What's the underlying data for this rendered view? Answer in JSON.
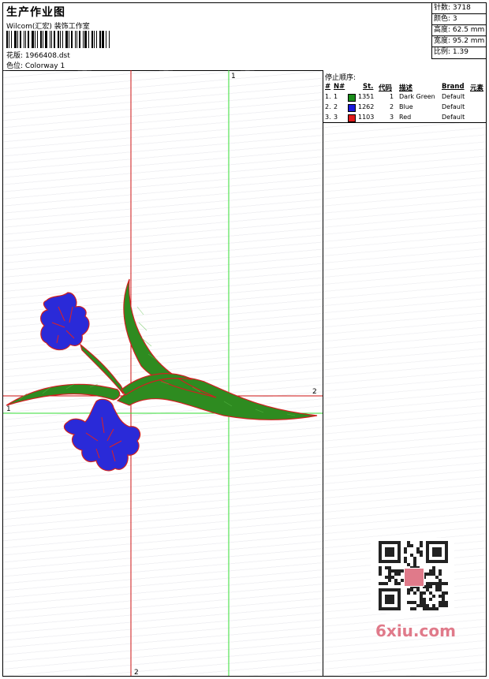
{
  "header": {
    "title": "生产作业图",
    "studio": "Wilcom(汇宏) 装饰工作室",
    "design_label": "花版: 1966408.dst",
    "colorway_label": "色位: Colorway 1"
  },
  "stats": {
    "stitches": "针数: 3718",
    "colors": "颜色: 3",
    "height": "高度: 62.5 mm",
    "width": "宽度: 95.2 mm",
    "ratio": "比例: 1.39"
  },
  "stop_sequence": {
    "title": "停止顺序:",
    "headers": [
      "#",
      "N#",
      "St.",
      "代码",
      "描述",
      "Brand",
      "元素"
    ],
    "rows": [
      {
        "index": "1.",
        "n": "1",
        "color": "#1a8c1a",
        "stitches": "1351",
        "code": "1",
        "desc": "Dark Green",
        "brand": "Default"
      },
      {
        "index": "2.",
        "n": "2",
        "color": "#1a1adc",
        "stitches": "1262",
        "code": "2",
        "desc": "Blue",
        "brand": "Default"
      },
      {
        "index": "3.",
        "n": "3",
        "color": "#e01a1a",
        "stitches": "1103",
        "code": "3",
        "desc": "Red",
        "brand": "Default"
      }
    ]
  },
  "axes": {
    "green_v": "1",
    "green_h": "1",
    "red_h": "2",
    "red_v": "2"
  },
  "watermark": {
    "brand": "6xiu.com",
    "seal": "以图会友"
  },
  "colors": {
    "green": "#2e8b20",
    "blue": "#2a2ad8",
    "red": "#e02020",
    "guide_green": "#33dd33",
    "guide_red": "#cc1111"
  }
}
